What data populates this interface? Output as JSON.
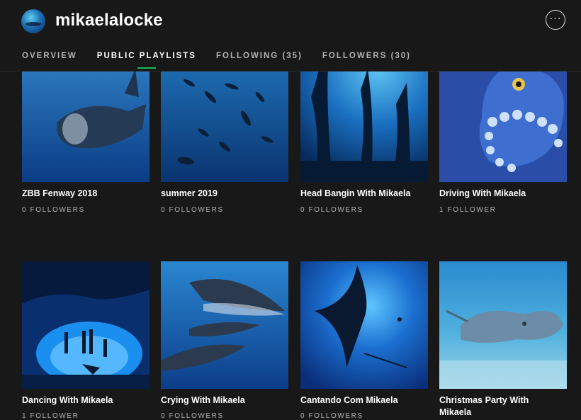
{
  "user": {
    "name": "mikaelalocke"
  },
  "header": {
    "more_label": "···"
  },
  "tabs": [
    {
      "label": "OVERVIEW",
      "active": false
    },
    {
      "label": "PUBLIC PLAYLISTS",
      "active": true
    },
    {
      "label": "FOLLOWING (35)",
      "active": false
    },
    {
      "label": "FOLLOWERS (30)",
      "active": false
    }
  ],
  "playlists": [
    {
      "title": "ZBB Fenway 2018",
      "followers": "0 FOLLOWERS",
      "art": "basking-shark"
    },
    {
      "title": "summer 2019",
      "followers": "0 FOLLOWERS",
      "art": "fish-school"
    },
    {
      "title": "Head Bangin With Mikaela",
      "followers": "0 FOLLOWERS",
      "art": "kelp-forest"
    },
    {
      "title": "Driving With Mikaela",
      "followers": "1 FOLLOWER",
      "art": "octopus"
    },
    {
      "title": "Dancing With Mikaela",
      "followers": "1 FOLLOWER",
      "art": "cave-divers"
    },
    {
      "title": "Crying With Mikaela",
      "followers": "0 FOLLOWERS",
      "art": "whales"
    },
    {
      "title": "Cantando Com Mikaela",
      "followers": "0 FOLLOWERS",
      "art": "manta-ray"
    },
    {
      "title": "Christmas Party With Mikaela",
      "followers": "",
      "art": "stingray"
    }
  ],
  "colors": {
    "accent": "#1db954",
    "background": "#181818",
    "muted": "#b3b3b3"
  }
}
